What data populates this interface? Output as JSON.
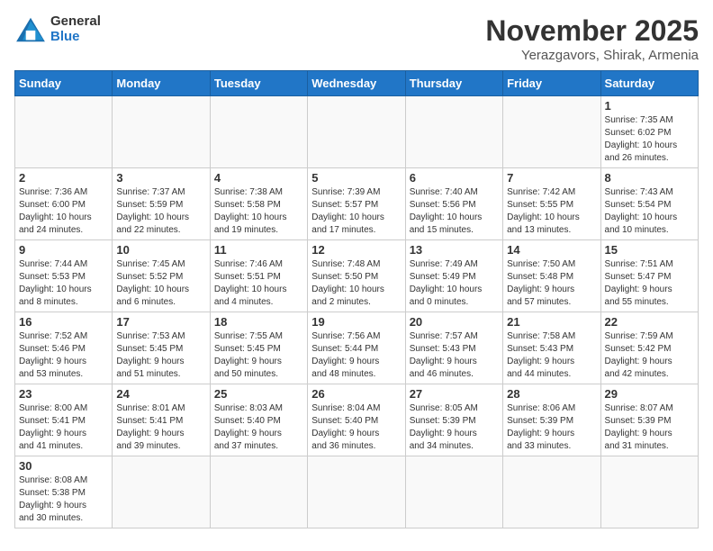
{
  "logo": {
    "text_general": "General",
    "text_blue": "Blue"
  },
  "header": {
    "month": "November 2025",
    "location": "Yerazgavors, Shirak, Armenia"
  },
  "weekdays": [
    "Sunday",
    "Monday",
    "Tuesday",
    "Wednesday",
    "Thursday",
    "Friday",
    "Saturday"
  ],
  "weeks": [
    [
      {
        "day": "",
        "info": ""
      },
      {
        "day": "",
        "info": ""
      },
      {
        "day": "",
        "info": ""
      },
      {
        "day": "",
        "info": ""
      },
      {
        "day": "",
        "info": ""
      },
      {
        "day": "",
        "info": ""
      },
      {
        "day": "1",
        "info": "Sunrise: 7:35 AM\nSunset: 6:02 PM\nDaylight: 10 hours\nand 26 minutes."
      }
    ],
    [
      {
        "day": "2",
        "info": "Sunrise: 7:36 AM\nSunset: 6:00 PM\nDaylight: 10 hours\nand 24 minutes."
      },
      {
        "day": "3",
        "info": "Sunrise: 7:37 AM\nSunset: 5:59 PM\nDaylight: 10 hours\nand 22 minutes."
      },
      {
        "day": "4",
        "info": "Sunrise: 7:38 AM\nSunset: 5:58 PM\nDaylight: 10 hours\nand 19 minutes."
      },
      {
        "day": "5",
        "info": "Sunrise: 7:39 AM\nSunset: 5:57 PM\nDaylight: 10 hours\nand 17 minutes."
      },
      {
        "day": "6",
        "info": "Sunrise: 7:40 AM\nSunset: 5:56 PM\nDaylight: 10 hours\nand 15 minutes."
      },
      {
        "day": "7",
        "info": "Sunrise: 7:42 AM\nSunset: 5:55 PM\nDaylight: 10 hours\nand 13 minutes."
      },
      {
        "day": "8",
        "info": "Sunrise: 7:43 AM\nSunset: 5:54 PM\nDaylight: 10 hours\nand 10 minutes."
      }
    ],
    [
      {
        "day": "9",
        "info": "Sunrise: 7:44 AM\nSunset: 5:53 PM\nDaylight: 10 hours\nand 8 minutes."
      },
      {
        "day": "10",
        "info": "Sunrise: 7:45 AM\nSunset: 5:52 PM\nDaylight: 10 hours\nand 6 minutes."
      },
      {
        "day": "11",
        "info": "Sunrise: 7:46 AM\nSunset: 5:51 PM\nDaylight: 10 hours\nand 4 minutes."
      },
      {
        "day": "12",
        "info": "Sunrise: 7:48 AM\nSunset: 5:50 PM\nDaylight: 10 hours\nand 2 minutes."
      },
      {
        "day": "13",
        "info": "Sunrise: 7:49 AM\nSunset: 5:49 PM\nDaylight: 10 hours\nand 0 minutes."
      },
      {
        "day": "14",
        "info": "Sunrise: 7:50 AM\nSunset: 5:48 PM\nDaylight: 9 hours\nand 57 minutes."
      },
      {
        "day": "15",
        "info": "Sunrise: 7:51 AM\nSunset: 5:47 PM\nDaylight: 9 hours\nand 55 minutes."
      }
    ],
    [
      {
        "day": "16",
        "info": "Sunrise: 7:52 AM\nSunset: 5:46 PM\nDaylight: 9 hours\nand 53 minutes."
      },
      {
        "day": "17",
        "info": "Sunrise: 7:53 AM\nSunset: 5:45 PM\nDaylight: 9 hours\nand 51 minutes."
      },
      {
        "day": "18",
        "info": "Sunrise: 7:55 AM\nSunset: 5:45 PM\nDaylight: 9 hours\nand 50 minutes."
      },
      {
        "day": "19",
        "info": "Sunrise: 7:56 AM\nSunset: 5:44 PM\nDaylight: 9 hours\nand 48 minutes."
      },
      {
        "day": "20",
        "info": "Sunrise: 7:57 AM\nSunset: 5:43 PM\nDaylight: 9 hours\nand 46 minutes."
      },
      {
        "day": "21",
        "info": "Sunrise: 7:58 AM\nSunset: 5:43 PM\nDaylight: 9 hours\nand 44 minutes."
      },
      {
        "day": "22",
        "info": "Sunrise: 7:59 AM\nSunset: 5:42 PM\nDaylight: 9 hours\nand 42 minutes."
      }
    ],
    [
      {
        "day": "23",
        "info": "Sunrise: 8:00 AM\nSunset: 5:41 PM\nDaylight: 9 hours\nand 41 minutes."
      },
      {
        "day": "24",
        "info": "Sunrise: 8:01 AM\nSunset: 5:41 PM\nDaylight: 9 hours\nand 39 minutes."
      },
      {
        "day": "25",
        "info": "Sunrise: 8:03 AM\nSunset: 5:40 PM\nDaylight: 9 hours\nand 37 minutes."
      },
      {
        "day": "26",
        "info": "Sunrise: 8:04 AM\nSunset: 5:40 PM\nDaylight: 9 hours\nand 36 minutes."
      },
      {
        "day": "27",
        "info": "Sunrise: 8:05 AM\nSunset: 5:39 PM\nDaylight: 9 hours\nand 34 minutes."
      },
      {
        "day": "28",
        "info": "Sunrise: 8:06 AM\nSunset: 5:39 PM\nDaylight: 9 hours\nand 33 minutes."
      },
      {
        "day": "29",
        "info": "Sunrise: 8:07 AM\nSunset: 5:39 PM\nDaylight: 9 hours\nand 31 minutes."
      }
    ],
    [
      {
        "day": "30",
        "info": "Sunrise: 8:08 AM\nSunset: 5:38 PM\nDaylight: 9 hours\nand 30 minutes."
      },
      {
        "day": "",
        "info": ""
      },
      {
        "day": "",
        "info": ""
      },
      {
        "day": "",
        "info": ""
      },
      {
        "day": "",
        "info": ""
      },
      {
        "day": "",
        "info": ""
      },
      {
        "day": "",
        "info": ""
      }
    ]
  ]
}
